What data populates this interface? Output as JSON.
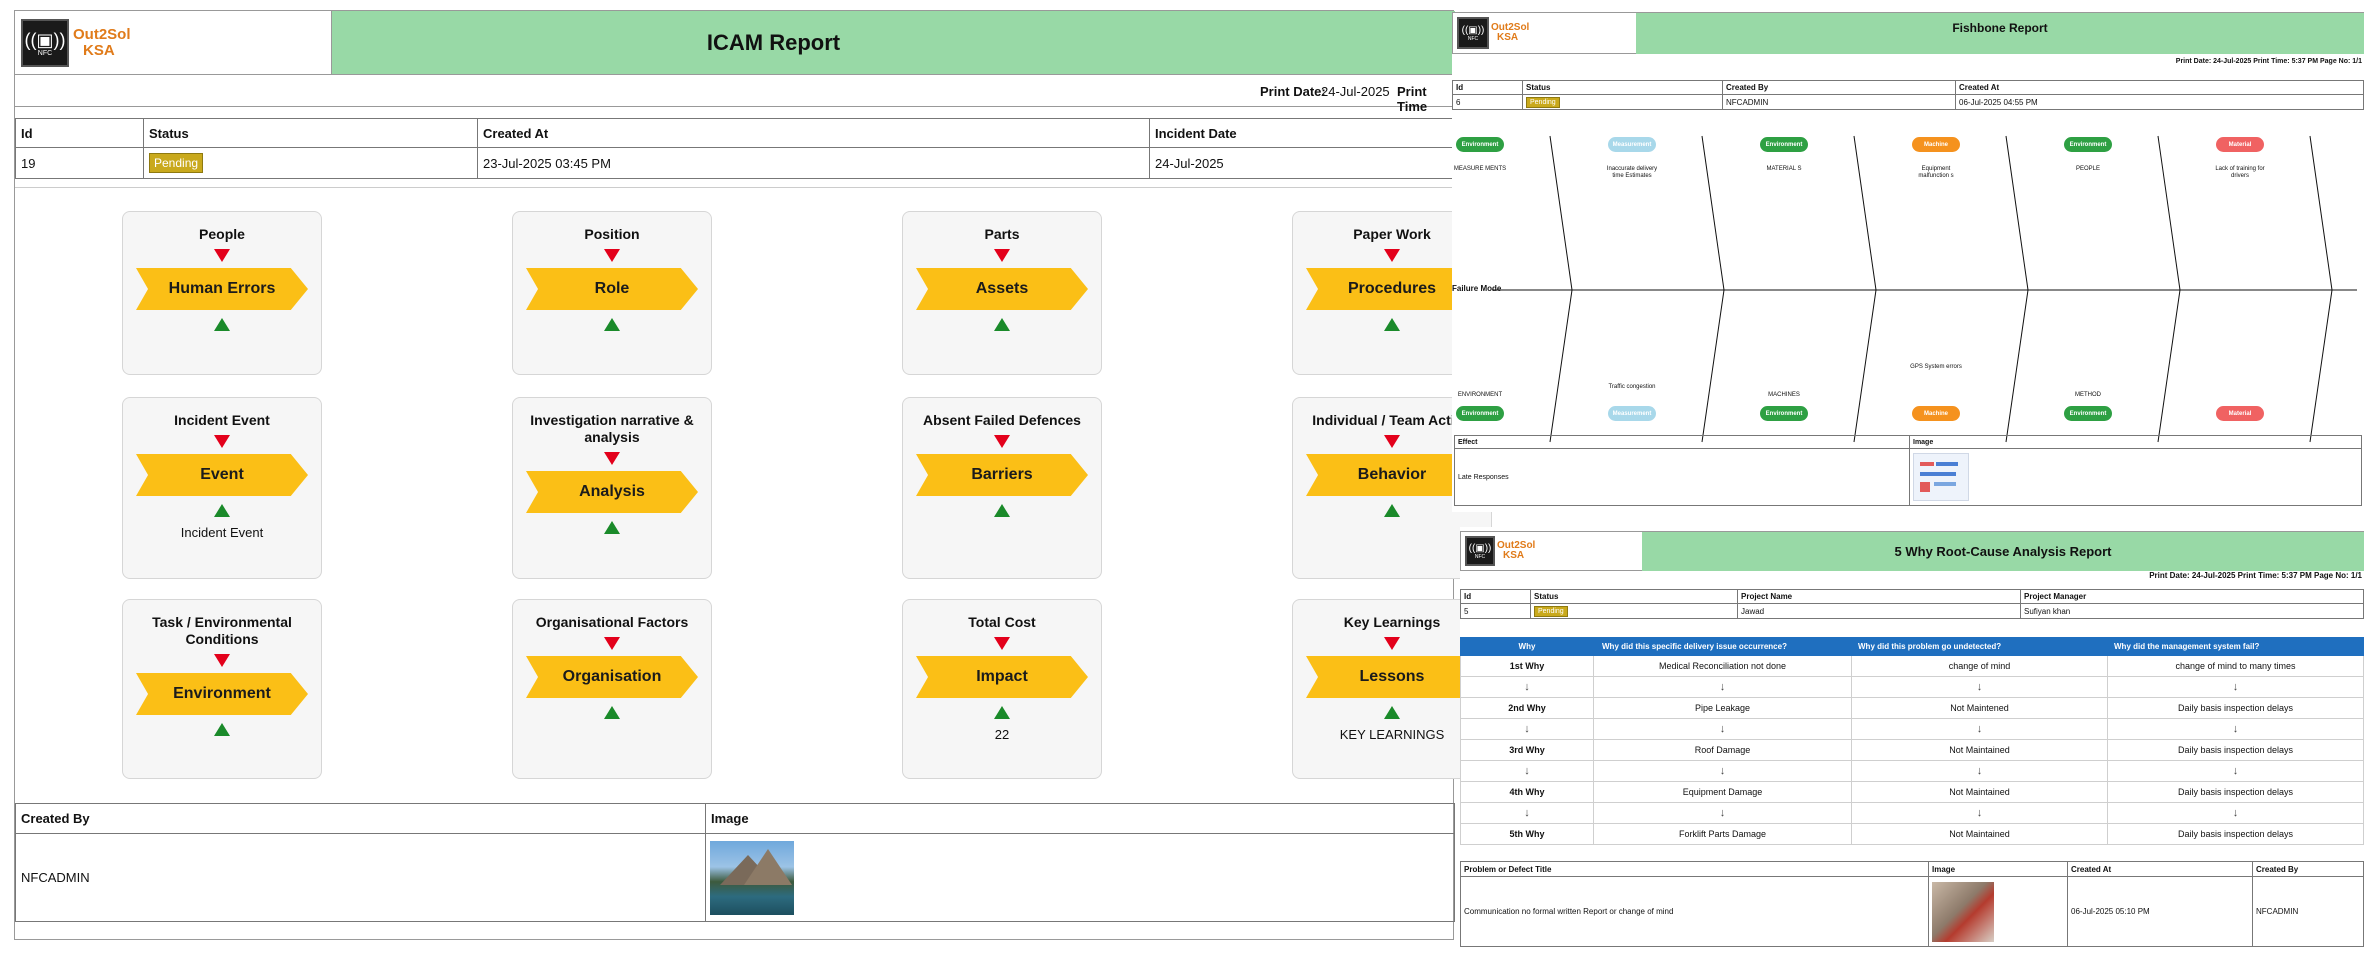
{
  "icam": {
    "logo": {
      "line1": "Out2Sol",
      "line2": "KSA",
      "chip": "NFC"
    },
    "title": "ICAM Report",
    "print_date_label": "Print Date:",
    "print_date": "24-Jul-2025",
    "print_time_label": "Print Time",
    "info_headers": [
      "Id",
      "Status",
      "Created At",
      "Incident Date"
    ],
    "info_values": {
      "id": "19",
      "status": "Pending",
      "created_at": "23-Jul-2025 03:45 PM",
      "incident_date": "24-Jul-2025"
    },
    "cards": [
      {
        "title": "People",
        "label": "Human Errors",
        "extra": ""
      },
      {
        "title": "Position",
        "label": "Role",
        "extra": ""
      },
      {
        "title": "Parts",
        "label": "Assets",
        "extra": ""
      },
      {
        "title": "Paper Work",
        "label": "Procedures",
        "extra": ""
      },
      {
        "title": "Incident Event",
        "label": "Event",
        "extra": "Incident Event"
      },
      {
        "title": "Investigation narrative & analysis",
        "label": "Analysis",
        "extra": ""
      },
      {
        "title": "Absent Failed Defences",
        "label": "Barriers",
        "extra": ""
      },
      {
        "title": "Individual / Team Action",
        "label": "Behavior",
        "extra": ""
      },
      {
        "title": "Task / Environmental Conditions",
        "label": "Environment",
        "extra": ""
      },
      {
        "title": "Organisational Factors",
        "label": "Organisation",
        "extra": ""
      },
      {
        "title": "Total Cost",
        "label": "Impact",
        "extra": "22"
      },
      {
        "title": "Key Learnings",
        "label": "Lessons",
        "extra": "KEY LEARNINGS"
      }
    ],
    "footer_headers": {
      "created_by": "Created By",
      "image": "Image"
    },
    "created_by": "NFCADMIN"
  },
  "fishbone": {
    "logo": {
      "line1": "Out2Sol",
      "line2": "KSA",
      "chip": "NFC"
    },
    "title": "Fishbone Report",
    "print_line": "Print Date: 24-Jul-2025 Print Time: 5:37 PM Page No: 1/1",
    "headers": [
      "Id",
      "Status",
      "Created By",
      "Created At"
    ],
    "values": {
      "id": "6",
      "status": "Pending",
      "created_by": "NFCADMIN",
      "created_at": "06-Jul-2025 04:55 PM"
    },
    "top_pills": [
      "Environment",
      "Measurement",
      "Environment",
      "Machine",
      "Environment",
      "Material"
    ],
    "top_texts": [
      "MEASURE MENTS",
      "Inaccurate delivery time Estimates",
      "MATERIAL S",
      "Equipment malfunction s",
      "PEOPLE",
      "Lack of training for drivers"
    ],
    "bottom_texts": [
      "ENVIRONMENT",
      "Traffic congestion",
      "MACHINES",
      "GPS System errors",
      "METHOD",
      ""
    ],
    "bottom_pills": [
      "Environment",
      "Measurement",
      "Environment",
      "Machine",
      "Environment",
      "Material"
    ],
    "failure_mode": "Failure Mode",
    "effect_header": "Effect",
    "image_header": "Image",
    "effect_value": "Late Responses",
    "colors": {
      "green": "#2ea043",
      "lightblue": "#a8d8ea",
      "orange": "#f5921e",
      "red": "#f06262"
    }
  },
  "five_why": {
    "logo": {
      "line1": "Out2Sol",
      "line2": "KSA",
      "chip": "NFC"
    },
    "title": "5 Why Root-Cause Analysis Report",
    "print_line": "Print Date: 24-Jul-2025  Print Time: 5:37 PM  Page No: 1/1",
    "headers": [
      "Id",
      "Status",
      "Project Name",
      "Project Manager"
    ],
    "values": {
      "id": "5",
      "status": "Pending",
      "project_name": "Jawad",
      "project_manager": "Sufiyan khan"
    },
    "why_headers": [
      "Why",
      "Why did this specific delivery issue occurrence?",
      "Why did this problem go undetected?",
      "Why did the management system fail?"
    ],
    "rows": [
      {
        "label": "1st Why",
        "c1": "Medical Reconciliation not done",
        "c2": "change of mind",
        "c3": "change of mind to many times"
      },
      {
        "label": "2nd Why",
        "c1": "Pipe Leakage",
        "c2": "Not Maintened",
        "c3": "Daily basis inspection delays"
      },
      {
        "label": "3rd Why",
        "c1": "Roof Damage",
        "c2": "Not Maintained",
        "c3": "Daily basis inspection delays"
      },
      {
        "label": "4th Why",
        "c1": "Equipment Damage",
        "c2": "Not Maintained",
        "c3": "Daily basis inspection delays"
      },
      {
        "label": "5th Why",
        "c1": "Forklift Parts Damage",
        "c2": "Not Maintained",
        "c3": "Daily basis inspection delays"
      }
    ],
    "arrow": "↓",
    "bottom_headers": [
      "Problem or Defect Title",
      "Image",
      "Created At",
      "Created By"
    ],
    "bottom_values": {
      "title": "Communication no formal written Report or change of mind",
      "created_at": "06-Jul-2025 05:10 PM",
      "created_by": "NFCADMIN"
    }
  }
}
